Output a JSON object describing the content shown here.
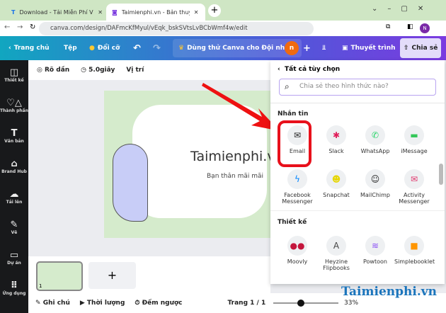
{
  "browser": {
    "tabs": [
      {
        "label": "Download - Tải Miễn Phí VN - P",
        "active": false
      },
      {
        "label": "Taimienphi.vn - Bản thuyết trình",
        "active": true
      }
    ],
    "url": "canva.com/design/DAFmcKfMyul/vEqk_bskSVtsLvBCbWmf4w/edit",
    "profile": "N"
  },
  "header": {
    "home": "Trang chủ",
    "file": "Tệp",
    "resize": "Đổi cỡ",
    "team_trial": "Dùng thử Canva cho Đội nhóm",
    "avatar": "n",
    "present": "Thuyết trình",
    "share": "Chia sẻ"
  },
  "sidebar": {
    "items": [
      {
        "label": "Thiết kế",
        "icon": "layout-icon"
      },
      {
        "label": "Thành phần",
        "icon": "shapes-icon"
      },
      {
        "label": "Văn bản",
        "icon": "text-icon"
      },
      {
        "label": "Brand Hub",
        "icon": "brand-icon"
      },
      {
        "label": "Tải lên",
        "icon": "upload-icon"
      },
      {
        "label": "Vẽ",
        "icon": "draw-icon"
      },
      {
        "label": "Dự án",
        "icon": "folder-icon"
      },
      {
        "label": "Ứng dụng",
        "icon": "apps-icon"
      }
    ]
  },
  "toolbar": {
    "fade": "Rõ dần",
    "duration": "5.0giây",
    "position": "Vị trí"
  },
  "slide": {
    "title": "Taimienphi.v",
    "subtitle": "Bạn thân mãi mãi"
  },
  "pages": {
    "thumb_number": "1",
    "add": "+"
  },
  "footer": {
    "notes": "Ghi chú",
    "timing": "Thời lượng",
    "timer": "Đếm ngược",
    "page": "Trang 1 / 1",
    "zoom": "33%",
    "zoom_fraction": 0.33
  },
  "share_panel": {
    "back": "Tất cả tùy chọn",
    "search_placeholder": "Chia sẻ theo hình thức nào?",
    "sections": [
      {
        "title": "Nhắn tin",
        "apps": [
          {
            "label": "Email",
            "icon": "✉",
            "color": "#222"
          },
          {
            "label": "Slack",
            "icon": "✱",
            "color": "#e01e5a"
          },
          {
            "label": "WhatsApp",
            "icon": "✆",
            "color": "#25d366"
          },
          {
            "label": "iMessage",
            "icon": "▬",
            "color": "#34c759"
          },
          {
            "label": "Facebook Messenger",
            "icon": "ϟ",
            "color": "#0084ff"
          },
          {
            "label": "Snapchat",
            "icon": "☻",
            "color": "#e6d600"
          },
          {
            "label": "MailChimp",
            "icon": "☺",
            "color": "#222"
          },
          {
            "label": "Activity Messenger",
            "icon": "✉",
            "color": "#e0356c"
          }
        ]
      },
      {
        "title": "Thiết kế",
        "apps": [
          {
            "label": "Moovly",
            "icon": "●●",
            "color": "#c4163d"
          },
          {
            "label": "Heyzine Flipbooks",
            "icon": "A",
            "color": "#444"
          },
          {
            "label": "Powtoon",
            "icon": "≋",
            "color": "#8a4ef5"
          },
          {
            "label": "Simplebooklet",
            "icon": "■",
            "color": "#ff9500"
          }
        ]
      }
    ]
  },
  "watermark": "Taimienphi.vn"
}
